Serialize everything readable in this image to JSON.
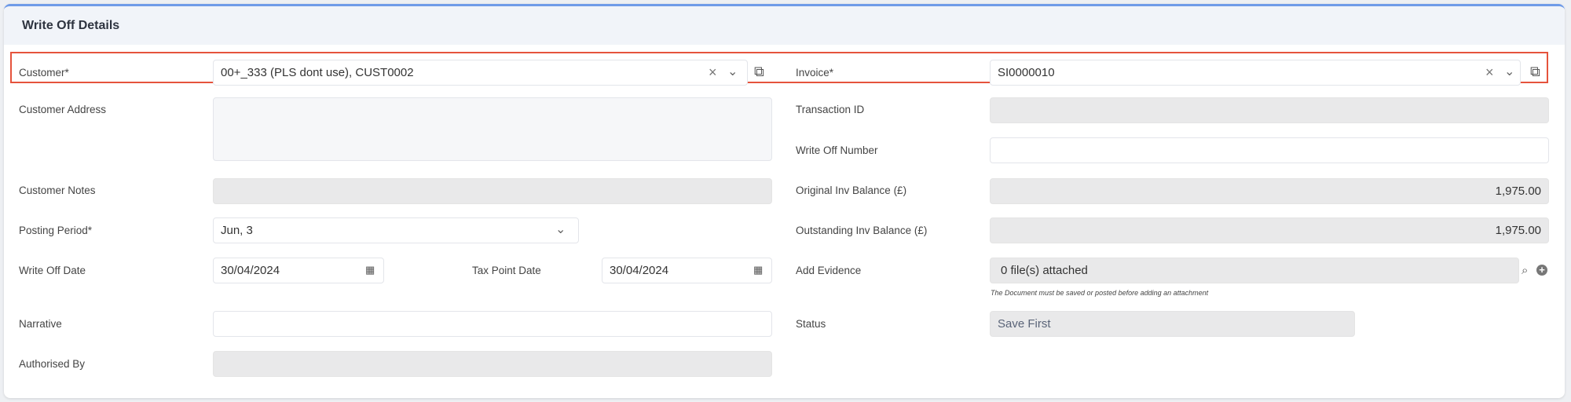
{
  "title": "Write Off Details",
  "left": {
    "customer": {
      "label": "Customer*",
      "value": "00+_333 (PLS dont use), CUST0002"
    },
    "customer_address": {
      "label": "Customer Address",
      "value": ""
    },
    "customer_notes": {
      "label": "Customer Notes",
      "value": ""
    },
    "posting_period": {
      "label": "Posting Period*",
      "value": "Jun, 3"
    },
    "write_off_date": {
      "label": "Write Off Date",
      "value": "30/04/2024"
    },
    "tax_point_date": {
      "label": "Tax Point Date",
      "value": "30/04/2024"
    },
    "narrative": {
      "label": "Narrative",
      "value": ""
    },
    "authorised_by": {
      "label": "Authorised By",
      "value": ""
    }
  },
  "right": {
    "invoice": {
      "label": "Invoice*",
      "value": "SI0000010"
    },
    "transaction_id": {
      "label": "Transaction ID",
      "value": ""
    },
    "write_off_number": {
      "label": "Write Off Number",
      "value": ""
    },
    "original_balance": {
      "label": "Original Inv Balance (£)",
      "value": "1,975.00"
    },
    "outstanding_balance": {
      "label": "Outstanding Inv Balance (£)",
      "value": "1,975.00"
    },
    "add_evidence": {
      "label": "Add Evidence",
      "value": "0 file(s) attached",
      "hint": "The Document must be saved or posted before adding an attachment"
    },
    "status": {
      "label": "Status",
      "value": "Save First"
    }
  },
  "colors": {
    "accent": "#6f9be8",
    "highlight": "#e5533c"
  }
}
